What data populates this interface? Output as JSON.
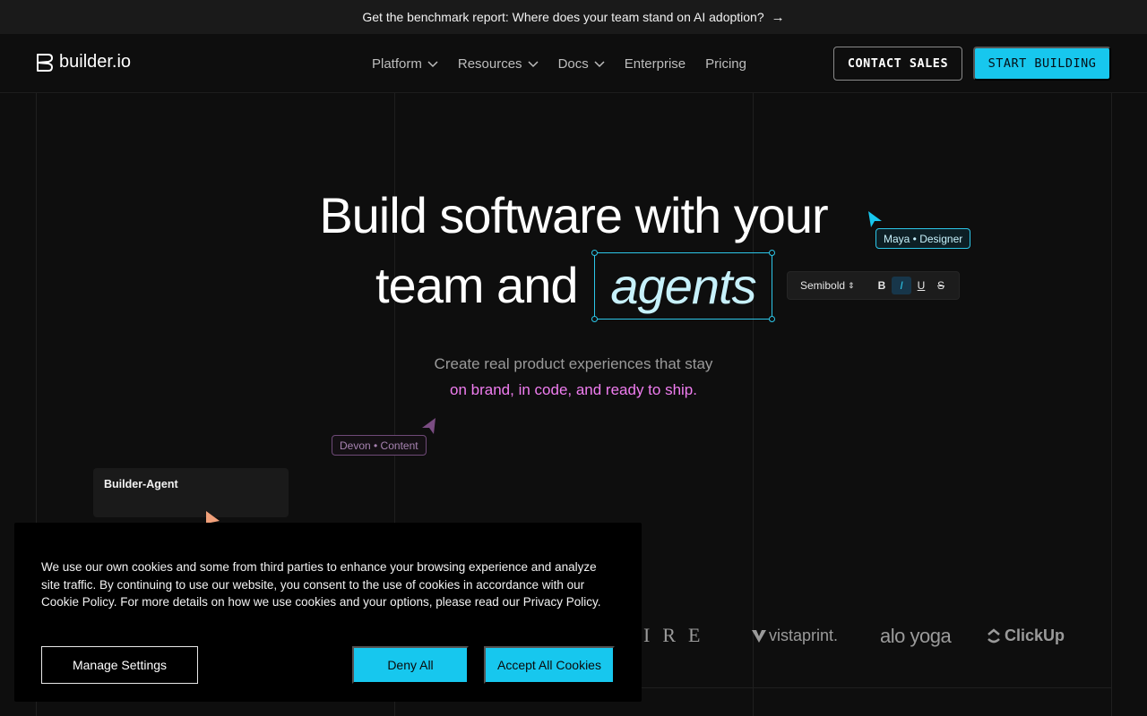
{
  "banner": {
    "text": "Get the benchmark report: Where does your team stand on AI adoption?",
    "arrow_icon": "arrow-right-icon"
  },
  "nav": {
    "brand": "builder.io",
    "items": [
      {
        "label": "Platform",
        "has_dropdown": true
      },
      {
        "label": "Resources",
        "has_dropdown": true
      },
      {
        "label": "Docs",
        "has_dropdown": true
      },
      {
        "label": "Enterprise",
        "has_dropdown": false
      },
      {
        "label": "Pricing",
        "has_dropdown": false
      }
    ],
    "contact_label": "CONTACT SALES",
    "start_label": "START BUILDING"
  },
  "hero": {
    "line1": "Build software with your",
    "line2": "team and",
    "highlight": "agents",
    "subtitle1": "Create real product experiences that stay",
    "subtitle2": "on brand, in code, and ready to ship."
  },
  "cursors": {
    "maya": "Maya • Designer",
    "devon": "Devon • Content"
  },
  "toolbar": {
    "font_weight": "Semibold",
    "bold": "B",
    "italic": "I",
    "underline": "U",
    "strike": "S"
  },
  "agent_card": {
    "title": "Builder-Agent"
  },
  "logos": {
    "partial": "IRE",
    "vistaprint": "vistaprint.",
    "alo": "alo yoga",
    "clickup": "ClickUp"
  },
  "cookie": {
    "text": "We use our own cookies and some from third parties to enhance your browsing experience and analyze site traffic. By continuing to use our website, you consent to the use of cookies in accordance with our Cookie Policy. For more details on how we use cookies and your options, please read our Privacy Policy.",
    "manage_label": "Manage Settings",
    "deny_label": "Deny All",
    "accept_label": "Accept All Cookies"
  },
  "colors": {
    "accent": "#17c7ee",
    "background": "#0e0e0e",
    "pink": "#f07df0"
  }
}
